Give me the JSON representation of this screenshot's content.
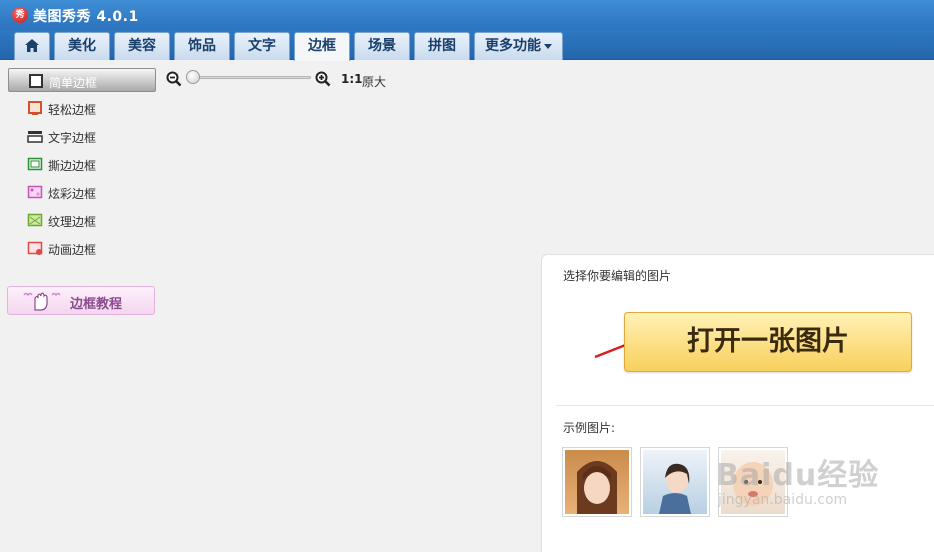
{
  "app": {
    "logo_text": "秀",
    "title": "美图秀秀 4.0.1"
  },
  "tabs": [
    {
      "label": "",
      "icon": "home-icon"
    },
    {
      "label": "美化"
    },
    {
      "label": "美容"
    },
    {
      "label": "饰品"
    },
    {
      "label": "文字"
    },
    {
      "label": "边框",
      "active": true
    },
    {
      "label": "场景"
    },
    {
      "label": "拼图"
    },
    {
      "label": "更多功能"
    }
  ],
  "sidebar": {
    "items": [
      {
        "label": "简单边框",
        "icon": "simple-frame-icon",
        "selected": true
      },
      {
        "label": "轻松边框",
        "icon": "easy-frame-icon"
      },
      {
        "label": "文字边框",
        "icon": "text-frame-icon"
      },
      {
        "label": "撕边边框",
        "icon": "torn-frame-icon"
      },
      {
        "label": "炫彩边框",
        "icon": "colorful-frame-icon"
      },
      {
        "label": "纹理边框",
        "icon": "texture-frame-icon"
      },
      {
        "label": "动画边框",
        "icon": "animation-frame-icon"
      }
    ],
    "tutorial_label": "边框教程"
  },
  "toolbar": {
    "ratio_label": "1:1",
    "original_label": "原大",
    "zoom_level": 0
  },
  "panel": {
    "title": "选择你要编辑的图片",
    "open_button": "打开一张图片",
    "sample_label": "示例图片:"
  },
  "watermark": {
    "brand": "Baidu经验",
    "url": "jingyan.baidu.com"
  },
  "colors": {
    "title_bar": "#3f8ed6",
    "open_button": "#f8d05c",
    "tutorial_text": "#8a4b8e"
  }
}
